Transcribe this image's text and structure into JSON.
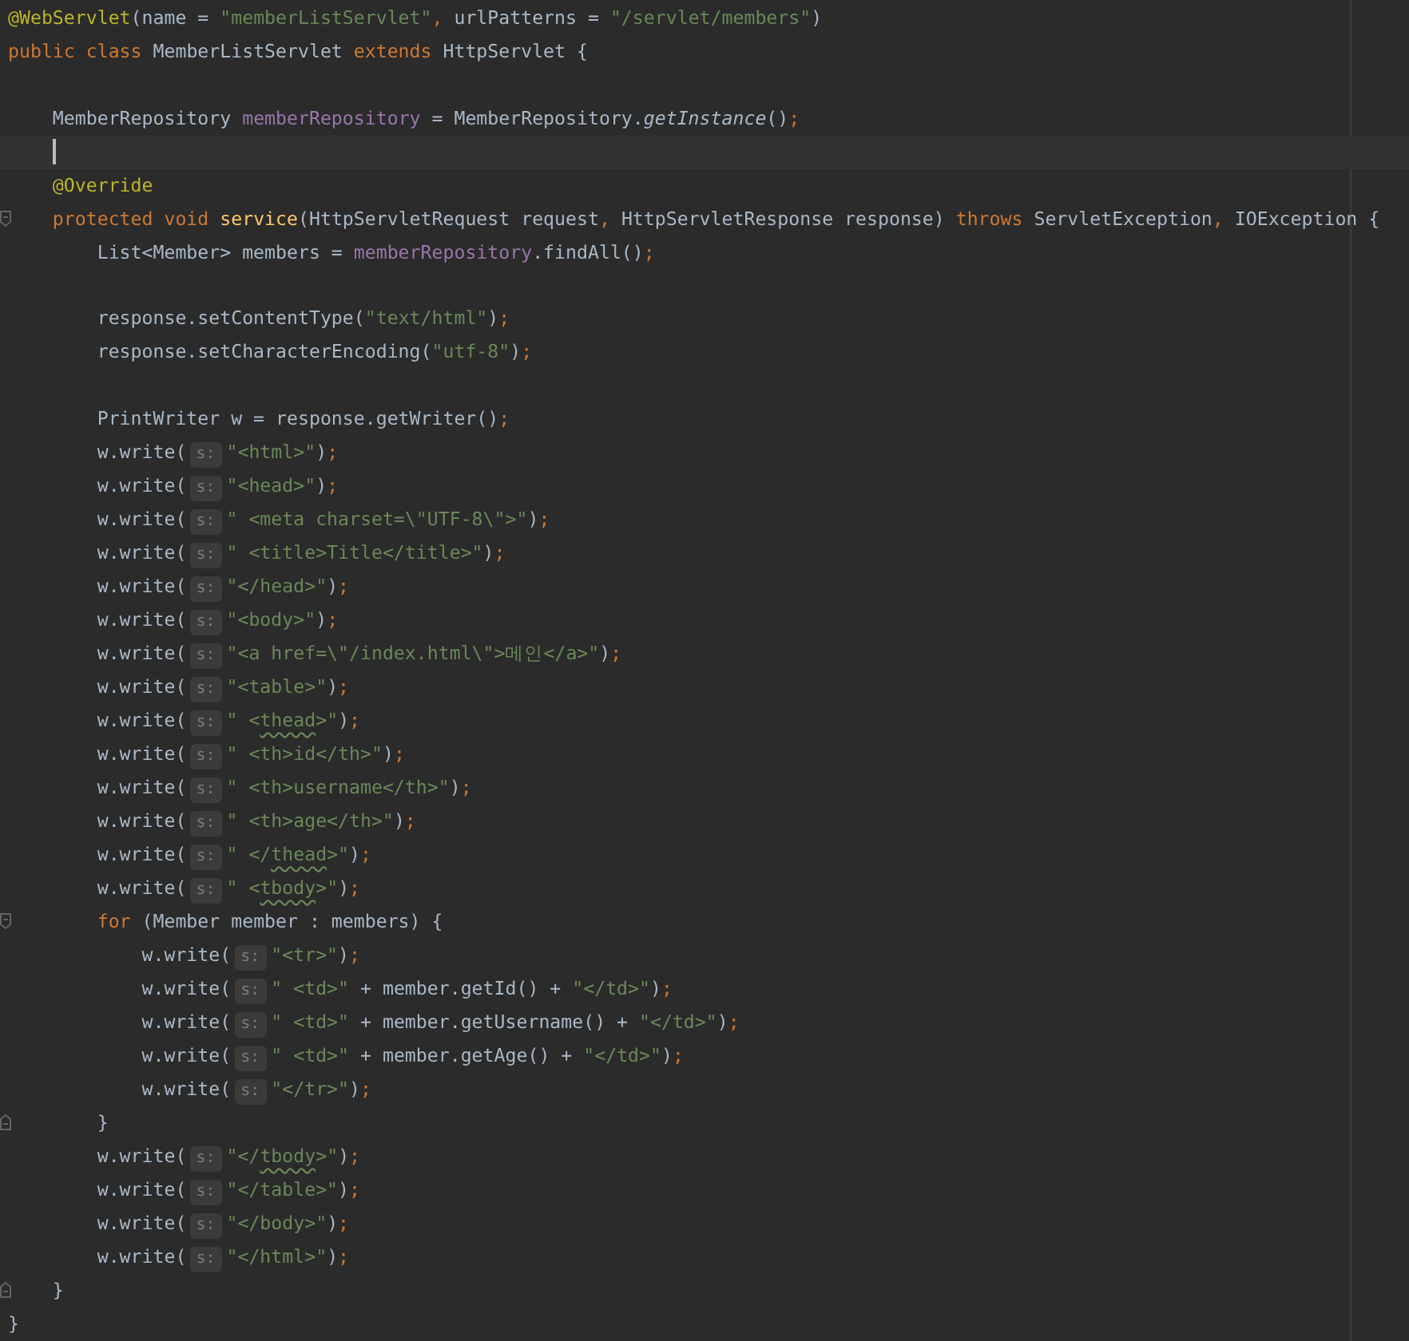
{
  "editor": {
    "lines": [
      {
        "current": false,
        "tokens": [
          {
            "kind": "annotation",
            "text": "@WebServlet"
          },
          {
            "kind": "plain",
            "text": "(name = "
          },
          {
            "kind": "string",
            "text": "\"memberListServlet\""
          },
          {
            "kind": "punct",
            "text": ", "
          },
          {
            "kind": "plain",
            "text": "urlPatterns = "
          },
          {
            "kind": "string",
            "text": "\"/servlet/members\""
          },
          {
            "kind": "plain",
            "text": ")"
          }
        ]
      },
      {
        "current": false,
        "tokens": [
          {
            "kind": "keyword",
            "text": "public class "
          },
          {
            "kind": "plain",
            "text": "MemberListServlet "
          },
          {
            "kind": "keyword",
            "text": "extends "
          },
          {
            "kind": "plain",
            "text": "HttpServlet {"
          }
        ]
      },
      {
        "current": false
      },
      {
        "current": false,
        "tokens": [
          {
            "kind": "plain",
            "text": "    MemberRepository "
          },
          {
            "kind": "field",
            "text": "memberRepository"
          },
          {
            "kind": "plain",
            "text": " = MemberRepository."
          },
          {
            "kind": "static",
            "text": "getInstance"
          },
          {
            "kind": "plain",
            "text": "()"
          },
          {
            "kind": "punct",
            "text": ";"
          }
        ]
      },
      {
        "current": true
      },
      {
        "current": false,
        "tokens": [
          {
            "kind": "annotation",
            "text": "    @Override"
          }
        ]
      },
      {
        "current": false,
        "fold_start": true,
        "tokens": [
          {
            "kind": "keyword",
            "text": "    protected void "
          },
          {
            "kind": "method",
            "text": "service"
          },
          {
            "kind": "plain",
            "text": "(HttpServletRequest request"
          },
          {
            "kind": "punct",
            "text": ", "
          },
          {
            "kind": "plain",
            "text": "HttpServletResponse response) "
          },
          {
            "kind": "keyword",
            "text": "throws "
          },
          {
            "kind": "plain",
            "text": "ServletException"
          },
          {
            "kind": "punct",
            "text": ", "
          },
          {
            "kind": "plain",
            "text": "IOException {"
          }
        ]
      },
      {
        "current": false,
        "tokens": [
          {
            "kind": "plain",
            "text": "        List<Member> members = "
          },
          {
            "kind": "field",
            "text": "memberRepository"
          },
          {
            "kind": "plain",
            "text": ".findAll()"
          },
          {
            "kind": "punct",
            "text": ";"
          }
        ]
      },
      {
        "current": false
      },
      {
        "current": false,
        "tokens": [
          {
            "kind": "plain",
            "text": "        response.setContentType("
          },
          {
            "kind": "string",
            "text": "\"text/html\""
          },
          {
            "kind": "plain",
            "text": ")"
          },
          {
            "kind": "punct",
            "text": ";"
          }
        ]
      },
      {
        "current": false,
        "tokens": [
          {
            "kind": "plain",
            "text": "        response.setCharacterEncoding("
          },
          {
            "kind": "string",
            "text": "\"utf-8\""
          },
          {
            "kind": "plain",
            "text": ")"
          },
          {
            "kind": "punct",
            "text": ";"
          }
        ]
      },
      {
        "current": false
      },
      {
        "current": false,
        "tokens": [
          {
            "kind": "plain",
            "text": "        PrintWriter w = response.getWriter()"
          },
          {
            "kind": "punct",
            "text": ";"
          }
        ]
      },
      {
        "current": false,
        "tokens": [
          {
            "kind": "plain",
            "text": "        w.write("
          },
          {
            "kind": "hint",
            "text": "s:"
          },
          {
            "kind": "string",
            "text": "\"<html>\""
          },
          {
            "kind": "plain",
            "text": ")"
          },
          {
            "kind": "punct",
            "text": ";"
          }
        ]
      },
      {
        "current": false,
        "tokens": [
          {
            "kind": "plain",
            "text": "        w.write("
          },
          {
            "kind": "hint",
            "text": "s:"
          },
          {
            "kind": "string",
            "text": "\"<head>\""
          },
          {
            "kind": "plain",
            "text": ")"
          },
          {
            "kind": "punct",
            "text": ";"
          }
        ]
      },
      {
        "current": false,
        "tokens": [
          {
            "kind": "plain",
            "text": "        w.write("
          },
          {
            "kind": "hint",
            "text": "s:"
          },
          {
            "kind": "string",
            "text": "\" <meta charset=\\\"UTF-8\\\">\""
          },
          {
            "kind": "plain",
            "text": ")"
          },
          {
            "kind": "punct",
            "text": ";"
          }
        ]
      },
      {
        "current": false,
        "tokens": [
          {
            "kind": "plain",
            "text": "        w.write("
          },
          {
            "kind": "hint",
            "text": "s:"
          },
          {
            "kind": "string",
            "text": "\" <title>Title</title>\""
          },
          {
            "kind": "plain",
            "text": ")"
          },
          {
            "kind": "punct",
            "text": ";"
          }
        ]
      },
      {
        "current": false,
        "tokens": [
          {
            "kind": "plain",
            "text": "        w.write("
          },
          {
            "kind": "hint",
            "text": "s:"
          },
          {
            "kind": "string",
            "text": "\"</head>\""
          },
          {
            "kind": "plain",
            "text": ")"
          },
          {
            "kind": "punct",
            "text": ";"
          }
        ]
      },
      {
        "current": false,
        "tokens": [
          {
            "kind": "plain",
            "text": "        w.write("
          },
          {
            "kind": "hint",
            "text": "s:"
          },
          {
            "kind": "string",
            "text": "\"<body>\""
          },
          {
            "kind": "plain",
            "text": ")"
          },
          {
            "kind": "punct",
            "text": ";"
          }
        ]
      },
      {
        "current": false,
        "tokens": [
          {
            "kind": "plain",
            "text": "        w.write("
          },
          {
            "kind": "hint",
            "text": "s:"
          },
          {
            "kind": "string",
            "text": "\"<a href=\\\"/index.html\\\">메인</a>\""
          },
          {
            "kind": "plain",
            "text": ")"
          },
          {
            "kind": "punct",
            "text": ";"
          }
        ]
      },
      {
        "current": false,
        "tokens": [
          {
            "kind": "plain",
            "text": "        w.write("
          },
          {
            "kind": "hint",
            "text": "s:"
          },
          {
            "kind": "string",
            "text": "\"<table>\""
          },
          {
            "kind": "plain",
            "text": ")"
          },
          {
            "kind": "punct",
            "text": ";"
          }
        ]
      },
      {
        "current": false,
        "tokens": [
          {
            "kind": "plain",
            "text": "        w.write("
          },
          {
            "kind": "hint",
            "text": "s:"
          },
          {
            "kind": "string",
            "text": "\" <"
          },
          {
            "kind": "typo",
            "text": "thead"
          },
          {
            "kind": "string",
            "text": ">\""
          },
          {
            "kind": "plain",
            "text": ")"
          },
          {
            "kind": "punct",
            "text": ";"
          }
        ]
      },
      {
        "current": false,
        "tokens": [
          {
            "kind": "plain",
            "text": "        w.write("
          },
          {
            "kind": "hint",
            "text": "s:"
          },
          {
            "kind": "string",
            "text": "\" <th>id</th>\""
          },
          {
            "kind": "plain",
            "text": ")"
          },
          {
            "kind": "punct",
            "text": ";"
          }
        ]
      },
      {
        "current": false,
        "tokens": [
          {
            "kind": "plain",
            "text": "        w.write("
          },
          {
            "kind": "hint",
            "text": "s:"
          },
          {
            "kind": "string",
            "text": "\" <th>username</th>\""
          },
          {
            "kind": "plain",
            "text": ")"
          },
          {
            "kind": "punct",
            "text": ";"
          }
        ]
      },
      {
        "current": false,
        "tokens": [
          {
            "kind": "plain",
            "text": "        w.write("
          },
          {
            "kind": "hint",
            "text": "s:"
          },
          {
            "kind": "string",
            "text": "\" <th>age</th>\""
          },
          {
            "kind": "plain",
            "text": ")"
          },
          {
            "kind": "punct",
            "text": ";"
          }
        ]
      },
      {
        "current": false,
        "tokens": [
          {
            "kind": "plain",
            "text": "        w.write("
          },
          {
            "kind": "hint",
            "text": "s:"
          },
          {
            "kind": "string",
            "text": "\" </"
          },
          {
            "kind": "typo",
            "text": "thead"
          },
          {
            "kind": "string",
            "text": ">\""
          },
          {
            "kind": "plain",
            "text": ")"
          },
          {
            "kind": "punct",
            "text": ";"
          }
        ]
      },
      {
        "current": false,
        "tokens": [
          {
            "kind": "plain",
            "text": "        w.write("
          },
          {
            "kind": "hint",
            "text": "s:"
          },
          {
            "kind": "string",
            "text": "\" <"
          },
          {
            "kind": "typo",
            "text": "tbody"
          },
          {
            "kind": "string",
            "text": ">\""
          },
          {
            "kind": "plain",
            "text": ")"
          },
          {
            "kind": "punct",
            "text": ";"
          }
        ]
      },
      {
        "current": false,
        "fold_start": true,
        "tokens": [
          {
            "kind": "keyword",
            "text": "        for "
          },
          {
            "kind": "plain",
            "text": "(Member member : members) {"
          }
        ]
      },
      {
        "current": false,
        "tokens": [
          {
            "kind": "plain",
            "text": "            w.write("
          },
          {
            "kind": "hint",
            "text": "s:"
          },
          {
            "kind": "string",
            "text": "\"<tr>\""
          },
          {
            "kind": "plain",
            "text": ")"
          },
          {
            "kind": "punct",
            "text": ";"
          }
        ]
      },
      {
        "current": false,
        "tokens": [
          {
            "kind": "plain",
            "text": "            w.write("
          },
          {
            "kind": "hint",
            "text": "s:"
          },
          {
            "kind": "string",
            "text": "\" <td>\""
          },
          {
            "kind": "plain",
            "text": " + member.getId() + "
          },
          {
            "kind": "string",
            "text": "\"</td>\""
          },
          {
            "kind": "plain",
            "text": ")"
          },
          {
            "kind": "punct",
            "text": ";"
          }
        ]
      },
      {
        "current": false,
        "tokens": [
          {
            "kind": "plain",
            "text": "            w.write("
          },
          {
            "kind": "hint",
            "text": "s:"
          },
          {
            "kind": "string",
            "text": "\" <td>\""
          },
          {
            "kind": "plain",
            "text": " + member.getUsername() + "
          },
          {
            "kind": "string",
            "text": "\"</td>\""
          },
          {
            "kind": "plain",
            "text": ")"
          },
          {
            "kind": "punct",
            "text": ";"
          }
        ]
      },
      {
        "current": false,
        "tokens": [
          {
            "kind": "plain",
            "text": "            w.write("
          },
          {
            "kind": "hint",
            "text": "s:"
          },
          {
            "kind": "string",
            "text": "\" <td>\""
          },
          {
            "kind": "plain",
            "text": " + member.getAge() + "
          },
          {
            "kind": "string",
            "text": "\"</td>\""
          },
          {
            "kind": "plain",
            "text": ")"
          },
          {
            "kind": "punct",
            "text": ";"
          }
        ]
      },
      {
        "current": false,
        "tokens": [
          {
            "kind": "plain",
            "text": "            w.write("
          },
          {
            "kind": "hint",
            "text": "s:"
          },
          {
            "kind": "string",
            "text": "\"</tr>\""
          },
          {
            "kind": "plain",
            "text": ")"
          },
          {
            "kind": "punct",
            "text": ";"
          }
        ]
      },
      {
        "current": false,
        "fold_end": true,
        "tokens": [
          {
            "kind": "plain",
            "text": "        }"
          }
        ]
      },
      {
        "current": false,
        "tokens": [
          {
            "kind": "plain",
            "text": "        w.write("
          },
          {
            "kind": "hint",
            "text": "s:"
          },
          {
            "kind": "string",
            "text": "\"</"
          },
          {
            "kind": "typo",
            "text": "tbody"
          },
          {
            "kind": "string",
            "text": ">\""
          },
          {
            "kind": "plain",
            "text": ")"
          },
          {
            "kind": "punct",
            "text": ";"
          }
        ]
      },
      {
        "current": false,
        "tokens": [
          {
            "kind": "plain",
            "text": "        w.write("
          },
          {
            "kind": "hint",
            "text": "s:"
          },
          {
            "kind": "string",
            "text": "\"</table>\""
          },
          {
            "kind": "plain",
            "text": ")"
          },
          {
            "kind": "punct",
            "text": ";"
          }
        ]
      },
      {
        "current": false,
        "tokens": [
          {
            "kind": "plain",
            "text": "        w.write("
          },
          {
            "kind": "hint",
            "text": "s:"
          },
          {
            "kind": "string",
            "text": "\"</body>\""
          },
          {
            "kind": "plain",
            "text": ")"
          },
          {
            "kind": "punct",
            "text": ";"
          }
        ]
      },
      {
        "current": false,
        "tokens": [
          {
            "kind": "plain",
            "text": "        w.write("
          },
          {
            "kind": "hint",
            "text": "s:"
          },
          {
            "kind": "string",
            "text": "\"</html>\""
          },
          {
            "kind": "plain",
            "text": ")"
          },
          {
            "kind": "punct",
            "text": ";"
          }
        ]
      },
      {
        "current": false,
        "fold_end": true,
        "tokens": [
          {
            "kind": "plain",
            "text": "    }"
          }
        ]
      },
      {
        "current": false,
        "tokens": [
          {
            "kind": "plain",
            "text": "}"
          }
        ]
      }
    ]
  }
}
